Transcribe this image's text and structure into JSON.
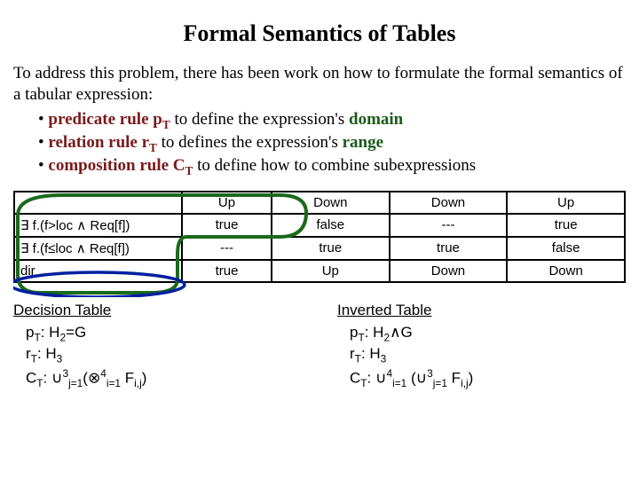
{
  "title": "Formal Semantics of Tables",
  "intro": "To address this problem, there has been work on how to formulate the formal semantics of a tabular expression:",
  "bullets": {
    "b1": {
      "term": "predicate rule p",
      "sub": "T",
      "rest": " to define the expression's ",
      "tail": "domain"
    },
    "b2": {
      "term": "relation rule r",
      "sub": "T",
      "rest": "  to defines the expression's ",
      "tail": "range"
    },
    "b3": {
      "term": "composition rule C",
      "sub": "T",
      "rest": "  to define how to combine subexpressions"
    }
  },
  "table": {
    "hdr": [
      "Up",
      "Down",
      "Down",
      "Up"
    ],
    "rows": [
      {
        "left": "∃ f.(f>loc ∧ Req[f])",
        "c": [
          "true",
          "false",
          "---",
          "true"
        ]
      },
      {
        "left": "∃ f.(f≤loc ∧ Req[f])",
        "c": [
          "---",
          "true",
          "true",
          "false"
        ]
      },
      {
        "left": "dir",
        "c": [
          "true",
          "Up",
          "Down",
          "Down"
        ]
      }
    ]
  },
  "decision": {
    "head": "Decision Table",
    "pT_label": "p",
    "pT_sub": "T",
    "pT_rest": ": H",
    "pT_sub2": "2",
    "pT_tail": "=G",
    "rT_label": "r",
    "rT_sub": "T",
    "rT_rest": ": H",
    "rT_sub2": "3",
    "cT_label": "C",
    "cT_sub": "T",
    "cT_rest": ": ",
    "cT_expr_outer_sup": "3",
    "cT_expr_outer_sub": "j=1",
    "cT_expr_inner_sup": "4",
    "cT_expr_inner_sub": "i=1",
    "cT_F": " F",
    "cT_Fsub": "i,j"
  },
  "inverted": {
    "head": "Inverted Table",
    "pT_label": "p",
    "pT_sub": "T",
    "pT_rest": ": H",
    "pT_sub2": "2",
    "pT_tail": "∧G",
    "rT_label": "r",
    "rT_sub": "T",
    "rT_rest": ": H",
    "rT_sub2": "3",
    "cT_label": "C",
    "cT_sub": "T",
    "cT_rest": ": ",
    "cT_expr_outer_sup": "4",
    "cT_expr_outer_sub": "i=1",
    "cT_expr_inner_sup": "3",
    "cT_expr_inner_sub": "j=1",
    "cT_F": " F",
    "cT_Fsub": "i,j"
  }
}
